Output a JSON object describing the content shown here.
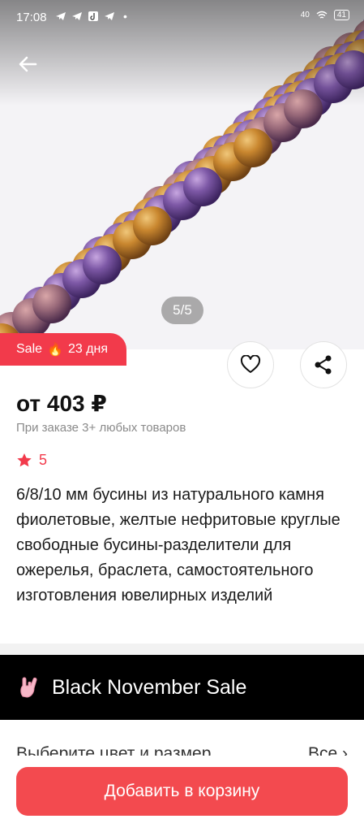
{
  "status_bar": {
    "time": "17:08",
    "right_info": "40",
    "battery": "41"
  },
  "gallery": {
    "counter": "5/5"
  },
  "sale_badge": {
    "label": "Sale",
    "emoji": "🔥",
    "days": "23 дня"
  },
  "product": {
    "price": "от 403 ₽",
    "price_note": "При заказе 3+ любых товаров",
    "rating": "5",
    "title": "6/8/10 мм бусины из натурального камня фиолетовые, желтые нефритовые круглые свободные бусины-разделители для ожерелья, браслета, самостоятельного изготовления ювелирных изделий"
  },
  "promo": {
    "label": "Black November Sale"
  },
  "options": {
    "label": "Выберите цвет и размер",
    "all": "Все"
  },
  "cart": {
    "button_label": "Добавить в корзину"
  },
  "colors": {
    "accent": "#f23a4b",
    "bead_purple": "#7d58a6",
    "bead_amber": "#c9872f"
  },
  "icons": [
    "back-arrow-icon",
    "heart-icon",
    "share-icon",
    "star-icon",
    "fire-icon",
    "rock-hand-icon",
    "chevron-right-icon"
  ]
}
